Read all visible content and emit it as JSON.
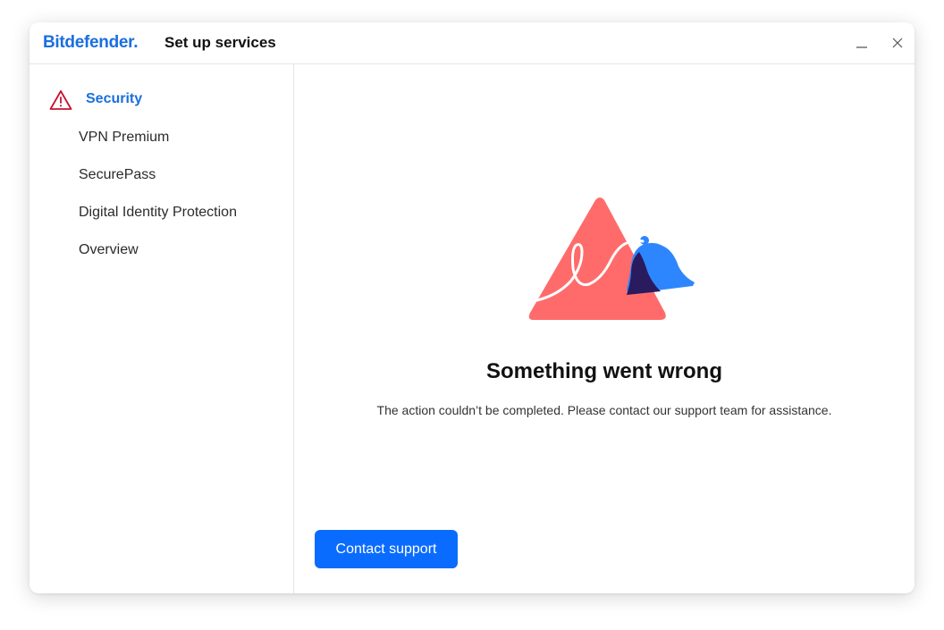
{
  "window": {
    "brand": "Bitdefender",
    "brand_dot": ".",
    "title": "Set up services",
    "minimize_icon": "minimize-icon",
    "close_icon": "close-icon"
  },
  "sidebar": {
    "items": [
      {
        "label": "Security",
        "active": true,
        "status_icon": "warning-icon",
        "status_color": "#c8102e"
      },
      {
        "label": "VPN Premium",
        "active": false
      },
      {
        "label": "SecurePass",
        "active": false
      },
      {
        "label": "Digital Identity Protection",
        "active": false
      },
      {
        "label": "Overview",
        "active": false
      }
    ]
  },
  "main": {
    "illustration": "warning-triangle-with-bell-illustration",
    "error_title": "Something went wrong",
    "error_message": "The action couldn’t be completed. Please contact our support team for assistance.",
    "primary_button": "Contact support"
  },
  "colors": {
    "accent": "#0a6cff",
    "brand": "#1a6fe0",
    "warning": "#c8102e",
    "illustration_triangle": "#ff6b6b",
    "illustration_bell": "#2e86ff",
    "illustration_bell_shadow": "#2a1a5e"
  }
}
